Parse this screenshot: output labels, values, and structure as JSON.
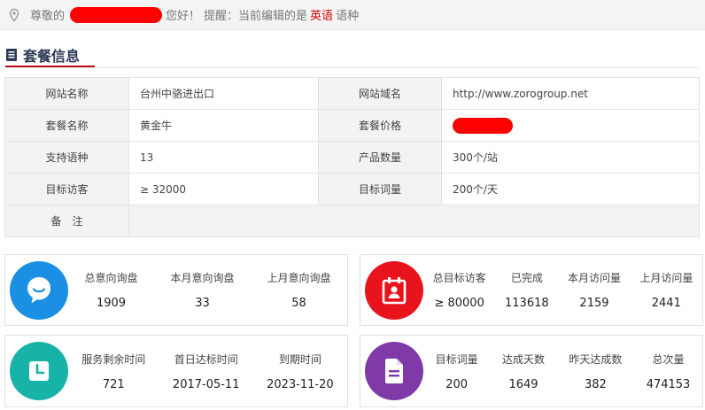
{
  "header": {
    "greeting_prefix": "尊敬的",
    "greeting_suffix": "您好！",
    "reminder_prefix": "提醒：当前编辑的是",
    "language": "英语",
    "reminder_suffix": "语种",
    "icons": {
      "location": "map-pin-icon"
    }
  },
  "section": {
    "title": "套餐信息",
    "icon": "document-icon"
  },
  "package_info": {
    "site_name_label": "网站名称",
    "site_name": "台州中骆进出口",
    "domain_label": "网站域名",
    "domain": "http://www.zorogroup.net",
    "package_name_label": "套餐名称",
    "package_name": "黄金牛",
    "price_label": "套餐价格",
    "languages_label": "支持语种",
    "languages": "13",
    "products_label": "产品数量",
    "products": "300个/站",
    "target_visitors_label": "目标访客",
    "target_visitors": "≥ 32000",
    "target_words_label": "目标词量",
    "target_words": "200个/天",
    "remark_label": "备　注"
  },
  "cards": {
    "inquiry": {
      "icon": "chat-bubble-icon",
      "color": "#1a8fe3",
      "labels": [
        "总意向询盘",
        "本月意向询盘",
        "上月意向询盘"
      ],
      "values": [
        "1909",
        "33",
        "58"
      ]
    },
    "visitors": {
      "icon": "calendar-user-icon",
      "color": "#e8131d",
      "labels": [
        "总目标访客",
        "已完成",
        "本月访问量",
        "上月访问量"
      ],
      "values": [
        "≥ 80000",
        "113618",
        "2159",
        "2441"
      ]
    },
    "service": {
      "icon": "clock-icon",
      "color": "#17b3a8",
      "labels": [
        "服务剩余时间",
        "首日达标时间",
        "到期时间"
      ],
      "values": [
        "721",
        "2017-05-11",
        "2023-11-20"
      ]
    },
    "keywords": {
      "icon": "file-icon",
      "color": "#7f3aa8",
      "labels": [
        "目标词量",
        "达成天数",
        "昨天达成数",
        "总次量"
      ],
      "values": [
        "200",
        "1649",
        "382",
        "474153"
      ]
    }
  }
}
